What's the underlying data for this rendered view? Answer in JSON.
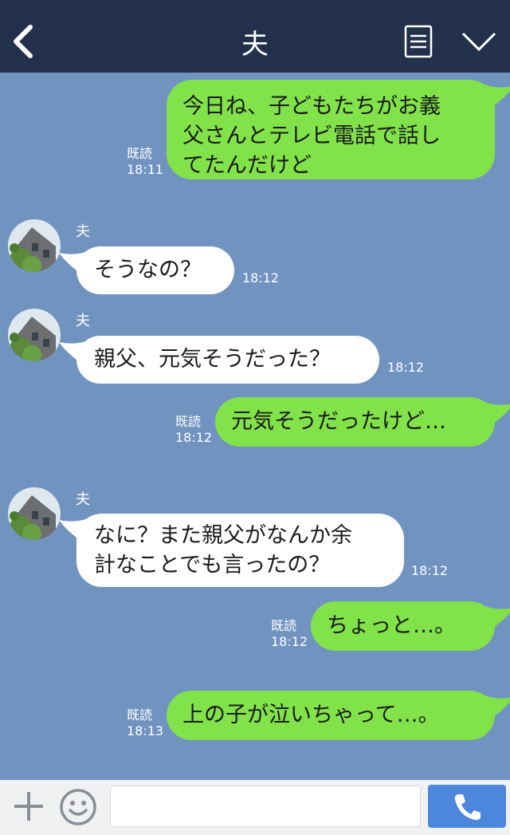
{
  "header": {
    "title": "夫",
    "back_icon": "chevron-left-icon",
    "menu_icon": "document-icon",
    "collapse_icon": "chevron-down-icon"
  },
  "messages": [
    {
      "side": "me",
      "text": "今日ね、子どもたちがお義\n父さんとテレビ電話で話し\nてたんだけど",
      "read": "既読",
      "time": "18:11"
    },
    {
      "side": "them",
      "sender": "夫",
      "text": "そうなの？",
      "time": "18:12"
    },
    {
      "side": "them",
      "sender": "夫",
      "text": "親父、元気そうだった？",
      "time": "18:12"
    },
    {
      "side": "me",
      "text": "元気そうだったけど…",
      "read": "既読",
      "time": "18:12"
    },
    {
      "side": "them",
      "sender": "夫",
      "text": "なに？また親父がなんか余\n計なことでも言ったの？",
      "time": "18:12"
    },
    {
      "side": "me",
      "text": "ちょっと…。",
      "read": "既読",
      "time": "18:12"
    },
    {
      "side": "me",
      "text": "上の子が泣いちゃって…。",
      "read": "既読",
      "time": "18:13"
    }
  ],
  "footer": {
    "input_value": "",
    "plus_icon": "plus-icon",
    "emoji_icon": "smiley-icon",
    "call_icon": "phone-icon"
  },
  "colors": {
    "header_bg": "#22304b",
    "chat_bg": "#7193c0",
    "my_bubble": "#82e24a",
    "their_bubble": "#ffffff",
    "call_button": "#4c86dd"
  }
}
